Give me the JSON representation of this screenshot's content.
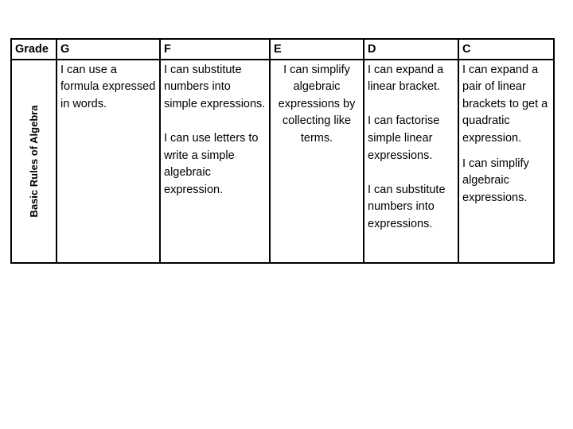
{
  "table": {
    "corner_header": "Grade",
    "row_label": "Basic Rules of Algebra",
    "grades": [
      {
        "grade": "G",
        "statements": [
          "I can use a formula expressed in words."
        ]
      },
      {
        "grade": "F",
        "statements": [
          "I can substitute numbers into simple expressions.",
          "I can use letters to write a simple algebraic expression."
        ]
      },
      {
        "grade": "E",
        "statements": [
          "I can simplify algebraic expressions by collecting like terms."
        ]
      },
      {
        "grade": "D",
        "statements": [
          "I can expand a linear bracket.",
          "I can factorise simple linear expressions.",
          "I can substitute numbers into expressions."
        ]
      },
      {
        "grade": "C",
        "statements": [
          "I can expand a pair of linear brackets to get a quadratic expression.",
          "I can simplify algebraic expressions."
        ]
      }
    ]
  }
}
